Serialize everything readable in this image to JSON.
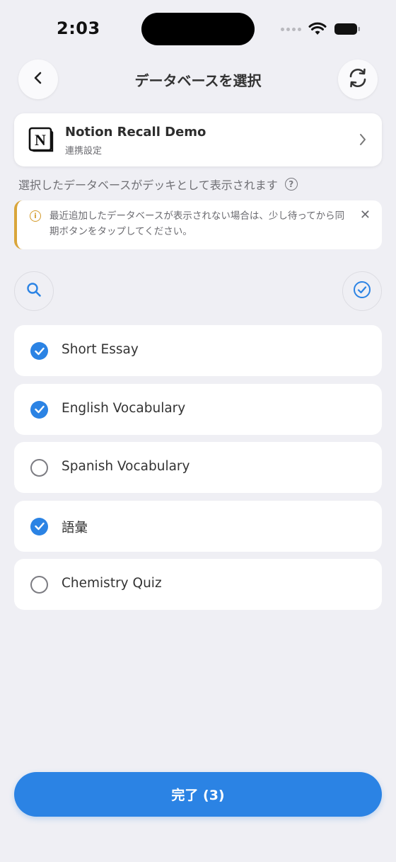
{
  "status_bar": {
    "time": "2:03"
  },
  "nav": {
    "title": "データベースを選択"
  },
  "connection": {
    "name": "Notion Recall Demo",
    "subtitle": "連携設定",
    "logo_letter": "N"
  },
  "hint": {
    "text": "選択したデータベースがデッキとして表示されます",
    "help_glyph": "?"
  },
  "notice": {
    "text": "最近追加したデータベースが表示されない場合は、少し待ってから同期ボタンをタップしてください。",
    "close_glyph": "✕",
    "icon_glyph": "i"
  },
  "databases": [
    {
      "label": "Short Essay",
      "selected": true
    },
    {
      "label": "English Vocabulary",
      "selected": true
    },
    {
      "label": "Spanish Vocabulary",
      "selected": false
    },
    {
      "label": "語彙",
      "selected": true
    },
    {
      "label": "Chemistry Quiz",
      "selected": false
    }
  ],
  "done_button": {
    "label": "完了 (3)"
  },
  "colors": {
    "accent": "#2b83e4",
    "background": "#efeff4",
    "notice_border": "#d9a53a"
  },
  "icons": {
    "back": "chevron-left-icon",
    "sync": "sync-icon",
    "chevron": "chevron-right-icon",
    "search": "search-icon",
    "select_all": "check-circle-icon"
  }
}
